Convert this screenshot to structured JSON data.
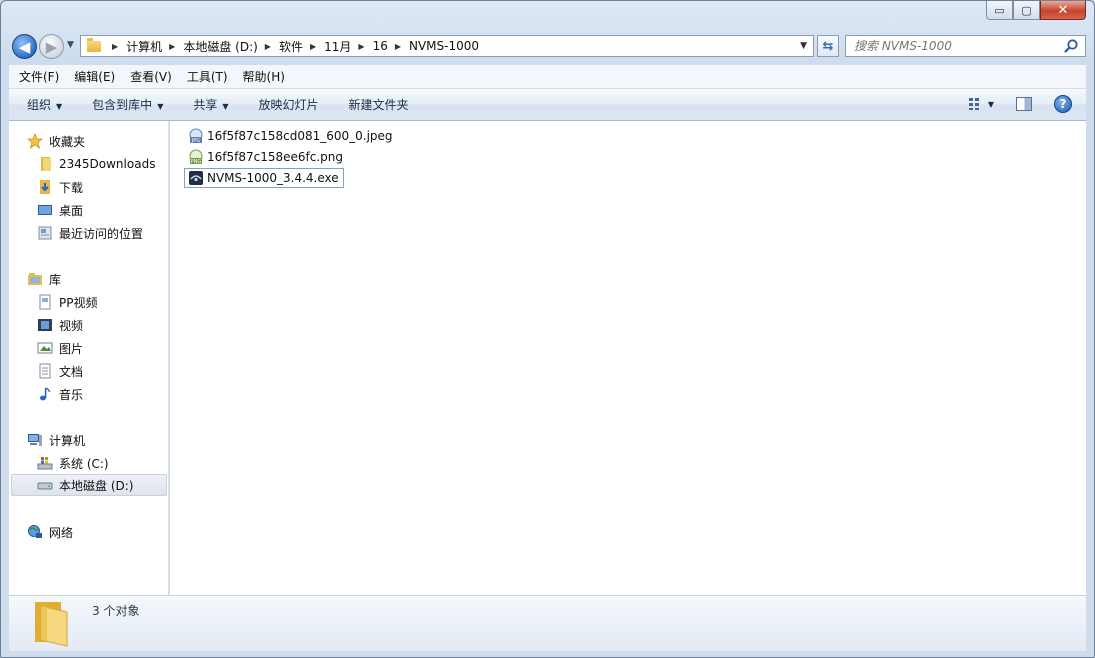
{
  "window": {
    "minimize_glyph": "▭",
    "maximize_glyph": "▢",
    "close_glyph": "✕"
  },
  "nav": {
    "back_glyph": "◀",
    "forward_glyph": "▶"
  },
  "address": {
    "crumbs": [
      "计算机",
      "本地磁盘 (D:)",
      "软件",
      "11月",
      "16",
      "NVMS-1000"
    ]
  },
  "search": {
    "placeholder": "搜索 NVMS-1000"
  },
  "menubar": {
    "items": [
      "文件(F)",
      "编辑(E)",
      "查看(V)",
      "工具(T)",
      "帮助(H)"
    ]
  },
  "commandbar": {
    "items": [
      {
        "label": "组织",
        "dropdown": true
      },
      {
        "label": "包含到库中",
        "dropdown": true
      },
      {
        "label": "共享",
        "dropdown": true
      },
      {
        "label": "放映幻灯片",
        "dropdown": false
      },
      {
        "label": "新建文件夹",
        "dropdown": false
      }
    ],
    "help_glyph": "?"
  },
  "navpane": {
    "favorites": {
      "label": "收藏夹",
      "items": [
        "2345Downloads",
        "下载",
        "桌面",
        "最近访问的位置"
      ]
    },
    "libraries": {
      "label": "库",
      "items": [
        "PP视频",
        "视频",
        "图片",
        "文档",
        "音乐"
      ]
    },
    "computer": {
      "label": "计算机",
      "items": [
        "系统 (C:)",
        "本地磁盘 (D:)"
      ],
      "selected": "本地磁盘 (D:)"
    },
    "network": {
      "label": "网络"
    }
  },
  "files": [
    {
      "name": "16f5f87c158cd081_600_0.jpeg",
      "icon": "jpeg-file-icon"
    },
    {
      "name": "16f5f87c158ee6fc.png",
      "icon": "png-file-icon"
    },
    {
      "name": "NVMS-1000_3.4.4.exe",
      "icon": "exe-file-icon",
      "focused": true
    }
  ],
  "details": {
    "count_text": "3 个对象"
  },
  "colors": {
    "accent": "#2f6fc8",
    "folder": "#e5b640",
    "selection_border": "#7da2ce"
  }
}
